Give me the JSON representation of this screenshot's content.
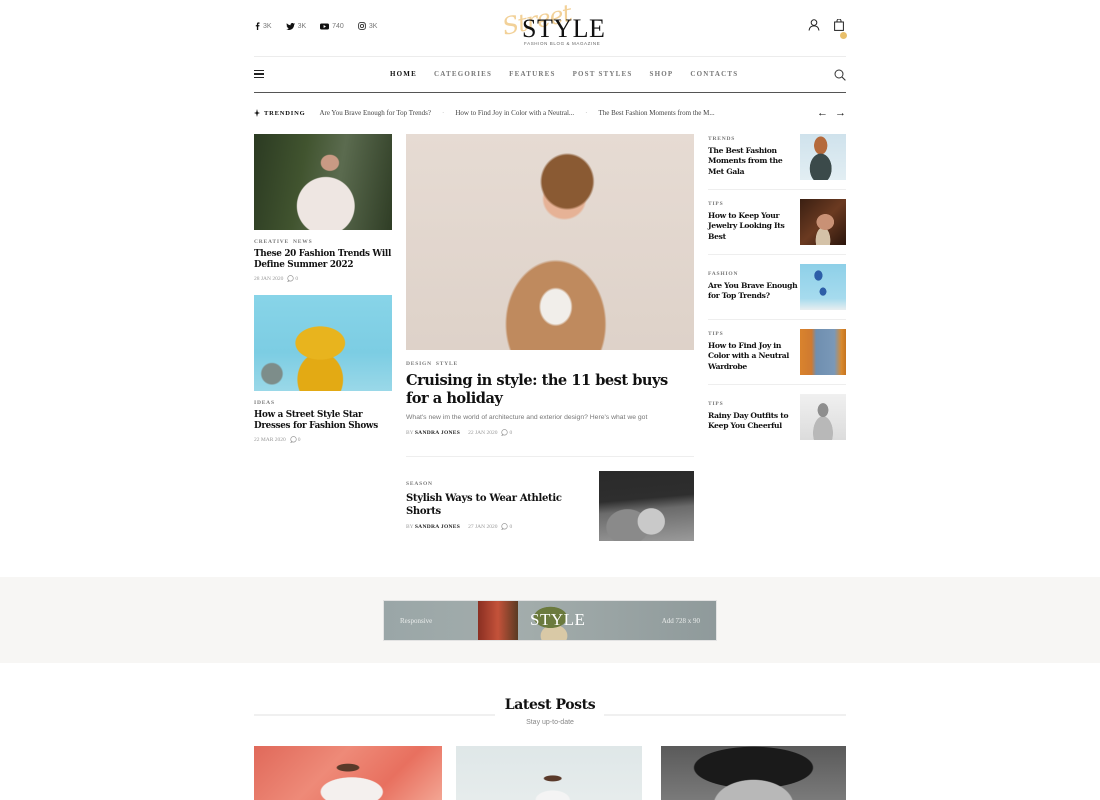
{
  "header": {
    "social": [
      {
        "icon": "facebook-icon",
        "count": "3K"
      },
      {
        "icon": "twitter-icon",
        "count": "3K"
      },
      {
        "icon": "youtube-icon",
        "count": "740"
      },
      {
        "icon": "instagram-icon",
        "count": "3K"
      }
    ],
    "logo": {
      "script": "Street",
      "main": "STYLE",
      "tagline": "FASHION BLOG & MAGAZINE"
    },
    "accent_color": "#e9c06c"
  },
  "nav": {
    "items": [
      {
        "label": "HOME",
        "active": true
      },
      {
        "label": "CATEGORIES",
        "active": false
      },
      {
        "label": "FEATURES",
        "active": false
      },
      {
        "label": "POST STYLES",
        "active": false
      },
      {
        "label": "SHOP",
        "active": false
      },
      {
        "label": "CONTACTS",
        "active": false
      }
    ]
  },
  "trending": {
    "label": "TRENDING",
    "items": [
      "Are You Brave Enough for Top Trends?",
      "How to Find Joy in Color with a Neutral...",
      "The Best Fashion Moments from the M..."
    ],
    "prev": "←",
    "next": "→"
  },
  "left_posts": [
    {
      "categories": [
        "CREATIVE",
        "NEWS"
      ],
      "title": "These 20 Fashion Trends Will Define Summer 2022",
      "date": "28 JAN 2020",
      "comments": "0"
    },
    {
      "categories": [
        "IDEAS"
      ],
      "title": "How a Street Style Star Dresses for Fashion Shows",
      "date": "22 MAR 2020",
      "comments": "0"
    }
  ],
  "featured": {
    "categories": [
      "DESIGN",
      "STYLE"
    ],
    "title": "Cruising in style: the 11 best buys for a holiday",
    "excerpt": "What's new im the world of architecture and exterior design? Here's what we got",
    "by": "BY",
    "author": "SANDRA JONES",
    "date": "22 JAN 2020",
    "comments": "0"
  },
  "secondary": {
    "categories": [
      "SEASON"
    ],
    "title": "Stylish Ways to Wear Athletic Shorts",
    "by": "BY",
    "author": "SANDRA JONES",
    "date": "27 JAN 2020",
    "comments": "0"
  },
  "right_posts": [
    {
      "category": "TRENDS",
      "title": "The Best Fashion Moments from the Met Gala"
    },
    {
      "category": "TIPS",
      "title": "How to Keep Your Jewelry Looking Its Best"
    },
    {
      "category": "FASHION",
      "title": "Are You Brave Enough for Top Trends?"
    },
    {
      "category": "TIPS",
      "title": "How to Find Joy in Color with a Neutral Wardrobe"
    },
    {
      "category": "TIPS",
      "title": "Rainy Day Outfits to Keep You Cheerful"
    }
  ],
  "ad": {
    "left": "Responsive",
    "brand": "STYLE",
    "right": "Add 728 x 90"
  },
  "latest": {
    "title": "Latest Posts",
    "subtitle": "Stay up-to-date"
  }
}
